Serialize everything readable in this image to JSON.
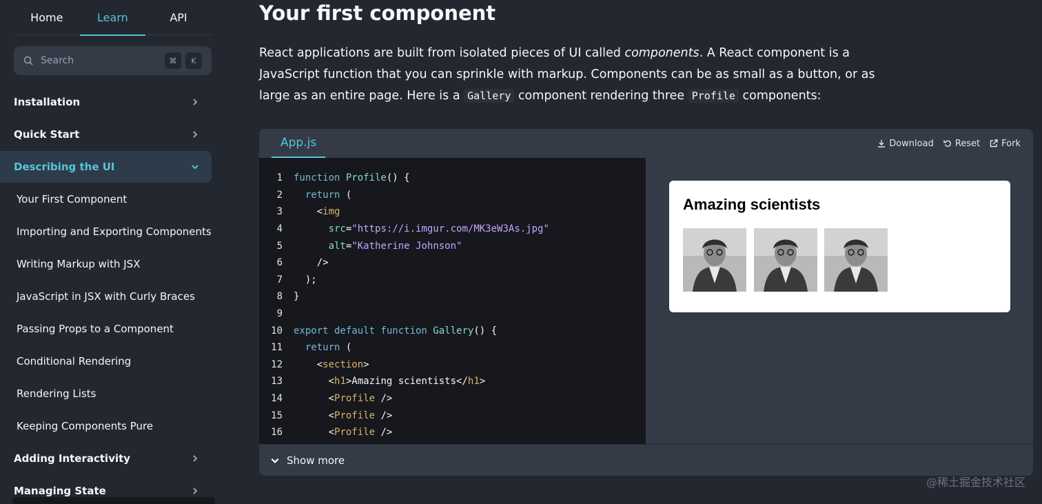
{
  "nav_tabs": [
    {
      "label": "Home"
    },
    {
      "label": "Learn",
      "active": true
    },
    {
      "label": "API"
    }
  ],
  "search": {
    "placeholder": "Search",
    "shortcut_keys": [
      "⌘",
      "K"
    ]
  },
  "sidebar": {
    "sections": [
      {
        "label": "Installation",
        "expanded": false
      },
      {
        "label": "Quick Start",
        "expanded": false
      },
      {
        "label": "Describing the UI",
        "expanded": true
      },
      {
        "label": "Adding Interactivity",
        "expanded": false
      },
      {
        "label": "Managing State",
        "expanded": false
      }
    ],
    "items": [
      {
        "label": "Your First Component"
      },
      {
        "label": "Importing and Exporting Components"
      },
      {
        "label": "Writing Markup with JSX"
      },
      {
        "label": "JavaScript in JSX with Curly Braces"
      },
      {
        "label": "Passing Props to a Component"
      },
      {
        "label": "Conditional Rendering"
      },
      {
        "label": "Rendering Lists"
      },
      {
        "label": "Keeping Components Pure"
      }
    ]
  },
  "main": {
    "title": "Your first component",
    "intro": {
      "p1": "React applications are built from isolated pieces of UI called ",
      "em": "components",
      "p2": ". A React component is a JavaScript function that you can sprinkle with markup. Components can be as small as a button, or as large as an entire page. Here is a ",
      "code1": "Gallery",
      "p3": " component rendering three ",
      "code2": "Profile",
      "p4": " components:"
    }
  },
  "sandbox": {
    "file_tab": "App.js",
    "actions": {
      "download": "Download",
      "reset": "Reset",
      "fork": "Fork"
    },
    "code_lines": [
      {
        "n": "1",
        "tokens": [
          [
            "kw",
            "function "
          ],
          [
            "fn",
            "Profile"
          ],
          [
            "txt",
            "() {"
          ]
        ]
      },
      {
        "n": "2",
        "tokens": [
          [
            "txt",
            "  "
          ],
          [
            "kw",
            "return"
          ],
          [
            "txt",
            " ("
          ]
        ]
      },
      {
        "n": "3",
        "tokens": [
          [
            "txt",
            "    <"
          ],
          [
            "tag",
            "img"
          ]
        ]
      },
      {
        "n": "4",
        "tokens": [
          [
            "txt",
            "      "
          ],
          [
            "attr",
            "src"
          ],
          [
            "txt",
            "="
          ],
          [
            "str",
            "\"https://i.imgur.com/MK3eW3As.jpg\""
          ]
        ]
      },
      {
        "n": "5",
        "tokens": [
          [
            "txt",
            "      "
          ],
          [
            "attr",
            "alt"
          ],
          [
            "txt",
            "="
          ],
          [
            "str",
            "\"Katherine Johnson\""
          ]
        ]
      },
      {
        "n": "6",
        "tokens": [
          [
            "txt",
            "    />"
          ]
        ]
      },
      {
        "n": "7",
        "tokens": [
          [
            "txt",
            "  );"
          ]
        ]
      },
      {
        "n": "8",
        "tokens": [
          [
            "txt",
            "}"
          ]
        ]
      },
      {
        "n": "9",
        "tokens": []
      },
      {
        "n": "10",
        "tokens": [
          [
            "kw",
            "export default function "
          ],
          [
            "fn",
            "Gallery"
          ],
          [
            "txt",
            "() {"
          ]
        ]
      },
      {
        "n": "11",
        "tokens": [
          [
            "txt",
            "  "
          ],
          [
            "kw",
            "return"
          ],
          [
            "txt",
            " ("
          ]
        ]
      },
      {
        "n": "12",
        "tokens": [
          [
            "txt",
            "    <"
          ],
          [
            "tag",
            "section"
          ],
          [
            "txt",
            ">"
          ]
        ]
      },
      {
        "n": "13",
        "tokens": [
          [
            "txt",
            "      <"
          ],
          [
            "tag",
            "h1"
          ],
          [
            "txt",
            ">Amazing scientists</"
          ],
          [
            "tag",
            "h1"
          ],
          [
            "txt",
            ">"
          ]
        ]
      },
      {
        "n": "14",
        "tokens": [
          [
            "txt",
            "      <"
          ],
          [
            "tag",
            "Profile"
          ],
          [
            "txt",
            " />"
          ]
        ]
      },
      {
        "n": "15",
        "tokens": [
          [
            "txt",
            "      <"
          ],
          [
            "tag",
            "Profile"
          ],
          [
            "txt",
            " />"
          ]
        ]
      },
      {
        "n": "16",
        "tokens": [
          [
            "txt",
            "      <"
          ],
          [
            "tag",
            "Profile"
          ],
          [
            "txt",
            " />"
          ]
        ]
      }
    ],
    "preview": {
      "heading": "Amazing scientists"
    },
    "show_more": "Show more"
  },
  "watermark": "@稀土掘金技术社区",
  "colors": {
    "accent": "#58c4dc",
    "background": "#23272f",
    "editor_bg": "#16181d"
  }
}
